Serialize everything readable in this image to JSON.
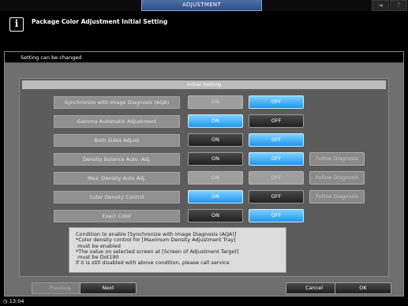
{
  "topbar": {
    "tab": "ADJUSTMENT",
    "icon_left": "speaker-icon",
    "icon_right": "help-icon",
    "help_glyph": "?"
  },
  "header": {
    "info_glyph": "i",
    "title": "Package Color Adjustment Initial Setting"
  },
  "status": "Setting can be changed",
  "panel_title": "Initial Setting",
  "rows": [
    {
      "label": "Synchronize with Image Diagnosis (AQA)",
      "on": "ON",
      "off": "OFF"
    },
    {
      "label": "Gamma Automatic Adjustment",
      "on": "ON",
      "off": "OFF"
    },
    {
      "label": "Both Sides Adjust",
      "on": "ON",
      "off": "OFF"
    },
    {
      "label": "Density Balance Auto. Adj.",
      "on": "ON",
      "off": "OFF",
      "follow": "Follow Diagnosis"
    },
    {
      "label": "Max. Density Auto Adj.",
      "on": "ON",
      "off": "OFF",
      "follow": "Follow Diagnosis"
    },
    {
      "label": "Color Density Control",
      "on": "ON",
      "off": "OFF",
      "follow": "Follow Diagnosis"
    },
    {
      "label": "Exact Color",
      "on": "ON",
      "off": "OFF"
    }
  ],
  "note": "Condition to enable [Synchronize with Image Diagnosis (AQA)]\n*Color density control for [Maximum Density Adjustment Tray]\n must be enabled\n*The value on selected screen at [Screen of Adjustment Target]\n must be Dot190\nIf it is still disabled with above condition, please call service",
  "footer": {
    "previous": "Previous",
    "next": "Next",
    "cancel": "Cancel",
    "ok": "OK"
  },
  "clock": "13:04"
}
